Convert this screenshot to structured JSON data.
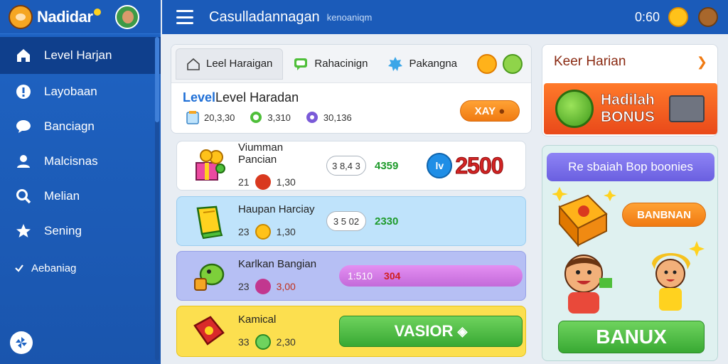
{
  "brand": {
    "name": "Nadidar"
  },
  "sidebar": {
    "items": [
      {
        "label": "Level Harjan",
        "icon": "home-icon"
      },
      {
        "label": "Layobaan",
        "icon": "alert-icon"
      },
      {
        "label": "Banciagn",
        "icon": "chat-icon"
      },
      {
        "label": "Malcisnas",
        "icon": "user-icon"
      },
      {
        "label": "Melian",
        "icon": "search-icon"
      },
      {
        "label": "Sening",
        "icon": "star-icon"
      },
      {
        "label": "Aebaniag",
        "icon": "check-icon"
      }
    ]
  },
  "header": {
    "title": "Casulladannagan",
    "subtitle": "kenoaniqm",
    "time": "0:60"
  },
  "tabs": [
    {
      "label": "Leel Haraigan",
      "icon": "home-icon"
    },
    {
      "label": "Rahacinign",
      "icon": "chat-icon"
    },
    {
      "label": "Pakangna",
      "icon": "badge-icon"
    }
  ],
  "level": {
    "title_highlight": "Level",
    "title_rest": "Level Haradan",
    "stats": [
      "20,3,30",
      "3,310",
      "30,136"
    ],
    "button": "XAY"
  },
  "rows": [
    {
      "name": "Viumman Pancian",
      "a": "21",
      "b": "1,30",
      "pill": "3 8,4 3",
      "green": "4359",
      "score_icon": "lv",
      "score": "2500"
    },
    {
      "name": "Haupan Harciay",
      "a": "23",
      "b": "1,30",
      "pill": "3 5 02",
      "green": "2330"
    },
    {
      "name": "Karlkan Bangian",
      "a": "23",
      "b": "3,00",
      "bar_text": "1:510",
      "bar_red": "304"
    },
    {
      "name": "Kamical",
      "a": "33",
      "b": "2,30",
      "button": "VASIOR"
    }
  ],
  "right": {
    "daily_title": "Keer Harian",
    "bonus_line1": "Hadilah",
    "bonus_line2": "BONUS",
    "promo_title": "Re sbaiah Bop boonies",
    "promo_pill": "BANBNAN",
    "promo_button": "BANUX"
  },
  "colors": {
    "primary": "#1b5bb9",
    "accent": "#f07a12",
    "green": "#38a933",
    "purple": "#6a5fe0"
  }
}
